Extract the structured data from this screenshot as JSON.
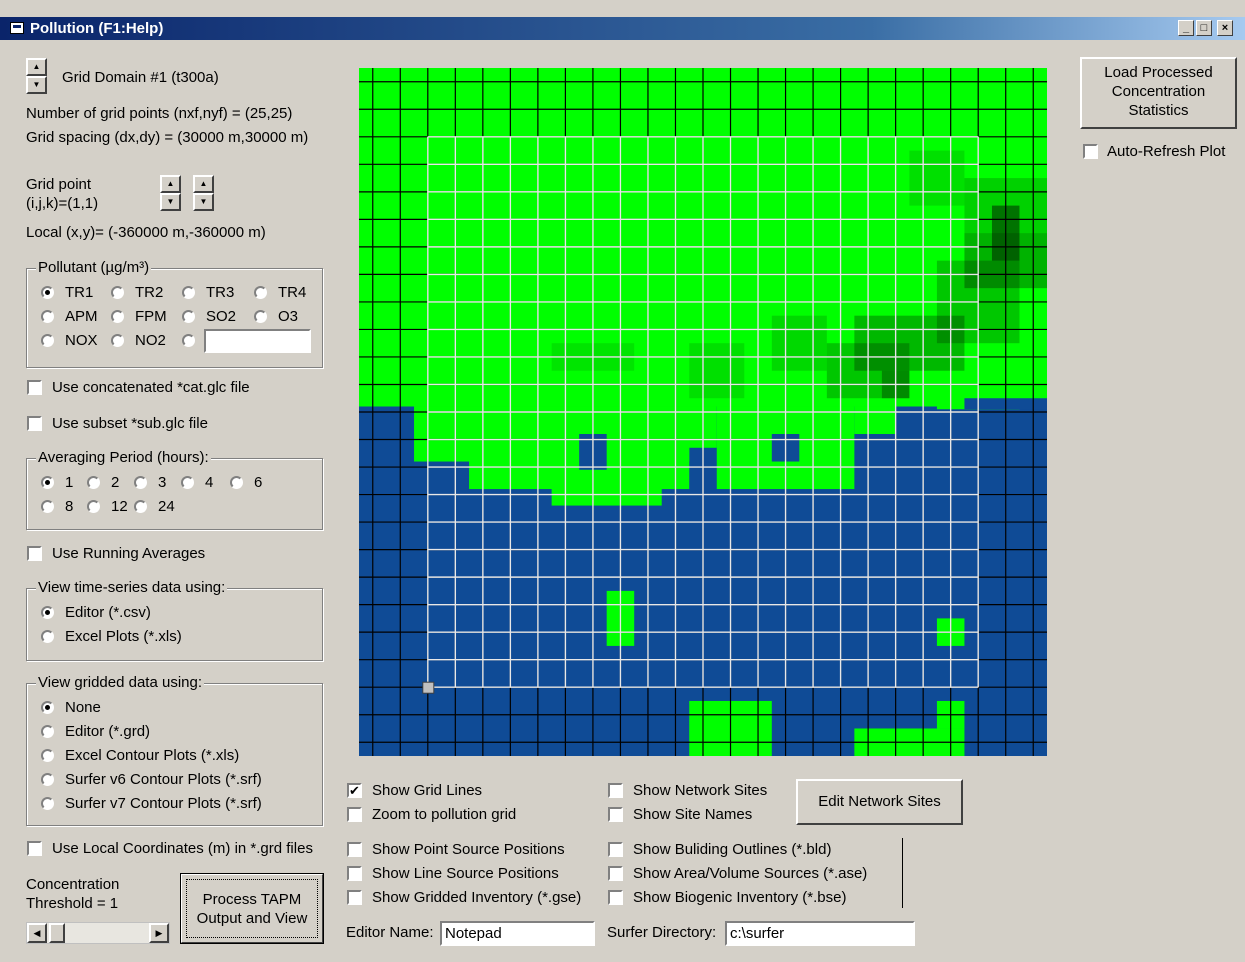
{
  "window": {
    "title": "Pollution (F1:Help)",
    "min": "_",
    "max": "□",
    "close": "×"
  },
  "domain": {
    "label": "Grid Domain #1 (t300a)",
    "num_points": "Number of grid points (nxf,nyf) = (25,25)",
    "spacing": "Grid spacing (dx,dy) = (30000 m,30000 m)",
    "grid_point_label": "Grid point",
    "grid_point_value": "(i,j,k)=(1,1)",
    "local_xy": "Local (x,y)= (-360000 m,-360000 m)"
  },
  "pollutant": {
    "legend": "Pollutant (µg/m³)",
    "options": [
      "TR1",
      "TR2",
      "TR3",
      "TR4",
      "APM",
      "FPM",
      "SO2",
      "O3",
      "NOX",
      "NO2"
    ],
    "selected": "TR1",
    "custom_value": ""
  },
  "checks": {
    "concat": "Use concatenated *cat.glc file",
    "subset": "Use subset *sub.glc file",
    "running": "Use Running Averages",
    "local_coords": "Use Local Coordinates (m) in *.grd files"
  },
  "averaging": {
    "legend": "Averaging Period (hours):",
    "options": [
      "1",
      "2",
      "3",
      "4",
      "6",
      "8",
      "12",
      "24"
    ],
    "selected": "1"
  },
  "timeseries": {
    "legend": "View time-series data using:",
    "options": [
      "Editor (*.csv)",
      "Excel Plots (*.xls)"
    ],
    "selected": "Editor (*.csv)"
  },
  "gridded": {
    "legend": "View gridded data using:",
    "options": [
      "None",
      "Editor (*.grd)",
      "Excel Contour Plots (*.xls)",
      "Surfer v6 Contour Plots (*.srf)",
      "Surfer v7 Contour Plots (*.srf)"
    ],
    "selected": "None"
  },
  "threshold": {
    "line1": "Concentration",
    "line2": "Threshold = 1",
    "value_fraction": 0.02
  },
  "process_button": {
    "line1": "Process TAPM",
    "line2": "Output and View"
  },
  "load_button": {
    "line1": "Load Processed",
    "line2": "Concentration",
    "line3": "Statistics"
  },
  "auto_refresh": "Auto-Refresh Plot",
  "display": {
    "show_grid_lines": "Show Grid Lines",
    "zoom_pollution": "Zoom to pollution grid",
    "show_point_sources": "Show Point Source Positions",
    "show_line_sources": "Show Line Source Positions",
    "show_gridded_inventory": "Show Gridded Inventory (*.gse)",
    "show_network_sites": "Show Network Sites",
    "show_site_names": "Show Site Names",
    "show_building_outlines": "Show Buliding Outlines (*.bld)",
    "show_area_volume": "Show Area/Volume Sources (*.ase)",
    "show_biogenic": "Show Biogenic Inventory (*.bse)",
    "edit_network_sites": "Edit Network Sites"
  },
  "editor": {
    "label": "Editor Name:",
    "value": "Notepad"
  },
  "surfer": {
    "label": "Surfer Directory:",
    "value": "c:\\surfer"
  },
  "colors": {
    "land": "#00ff00",
    "water": "#0f4b96",
    "inner_grid": "#e8e8e8",
    "outer_grid": "#000000"
  }
}
